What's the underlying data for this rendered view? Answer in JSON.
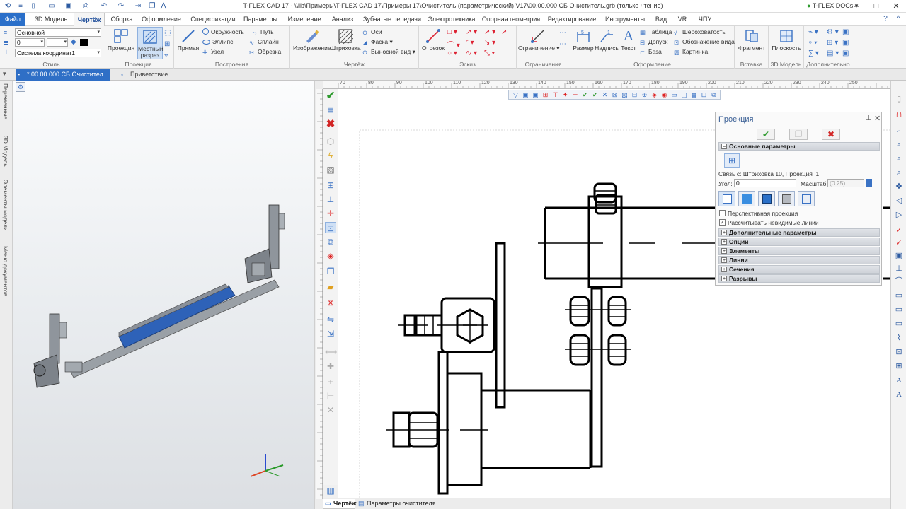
{
  "window": {
    "title": "T-FLEX CAD 17 - \\\\lib\\Примеры\\T-FLEX CAD 17\\Примеры 17\\Очиститель (параметрический) V17\\00.00.000 СБ Очиститель.grb (только чтение)",
    "docs_label": "T-FLEX DOCs"
  },
  "menu_tabs": [
    "Файл",
    "3D Модель",
    "Чертёж",
    "Сборка",
    "Оформление",
    "Спецификации",
    "Параметры",
    "Измерение",
    "Анализ",
    "Зубчатые передачи",
    "Электротехника",
    "Опорная геометрия",
    "Редактирование",
    "Инструменты",
    "Вид",
    "VR",
    "ЧПУ"
  ],
  "ribbon": {
    "style": {
      "layer": "Основной",
      "line_value": "0",
      "coord": "Система координат1",
      "group": "Стиль"
    },
    "projection": {
      "proj_label": "Проекция",
      "section_label": "Местный разрез",
      "group": "Проекция"
    },
    "construction": {
      "line_label": "Прямая",
      "circle": "Окружность",
      "ellipse": "Эллипс",
      "node": "Узел",
      "path": "Путь",
      "spline": "Сплайн",
      "trim": "Обрезка",
      "group": "Построения"
    },
    "drawing": {
      "image_label": "Изображение",
      "hatch_label": "Штриховка",
      "axes": "Оси",
      "chamfer": "Фаска",
      "detail_view": "Выносной вид",
      "group": "Чертёж"
    },
    "sketch": {
      "segment_label": "Отрезок",
      "group": "Эскиз"
    },
    "constraints": {
      "constraint_label": "Ограничение",
      "group": "Ограничения"
    },
    "annotation": {
      "dimension": "Размер",
      "label": "Надпись",
      "text": "Текст",
      "table": "Таблица",
      "tolerance": "Допуск",
      "base": "База",
      "roughness": "Шероховатость",
      "view_label": "Обозначение вида",
      "picture": "Картинка",
      "group": "Оформление"
    },
    "insert": {
      "fragment": "Фрагмент",
      "group": "Вставка"
    },
    "model3d": {
      "plane": "Плоскость",
      "group": "3D Модель"
    },
    "extra": {
      "group": "Дополнительно"
    }
  },
  "doc_tabs": {
    "active": "* 00.00.000 СБ Очистител...",
    "welcome": "Приветствие"
  },
  "left_strip": [
    "Переменные",
    "3D Модель",
    "Элементы модели",
    "Меню документов"
  ],
  "ruler_marks": [
    "70",
    "80",
    "90",
    "100",
    "110",
    "120",
    "130",
    "140",
    "150",
    "160",
    "170",
    "180",
    "190",
    "200",
    "210",
    "220",
    "230",
    "240",
    "250"
  ],
  "panel": {
    "title": "Проекция",
    "section_main": "Основные параметры",
    "link_label": "Связь с:",
    "link_value": "Штриховка 10, Проекция_1",
    "angle_label": "Угол:",
    "angle_value": "0",
    "scale_label": "Масштаб:",
    "scale_value": "(0.25)",
    "perspective": "Перспективная проекция",
    "hidden_lines": "Рассчитывать невидимые линии",
    "sections": [
      "Дополнительные параметры",
      "Опции",
      "Элементы",
      "Линии",
      "Сечения",
      "Разрывы"
    ]
  },
  "bottom_tabs": {
    "drawing": "Чертёж",
    "params": "Параметры очистителя"
  },
  "colors": {
    "accent": "#2a6fc9",
    "belt": "#2e62b8",
    "ok": "#2e9a2e",
    "cancel": "#d22424"
  }
}
